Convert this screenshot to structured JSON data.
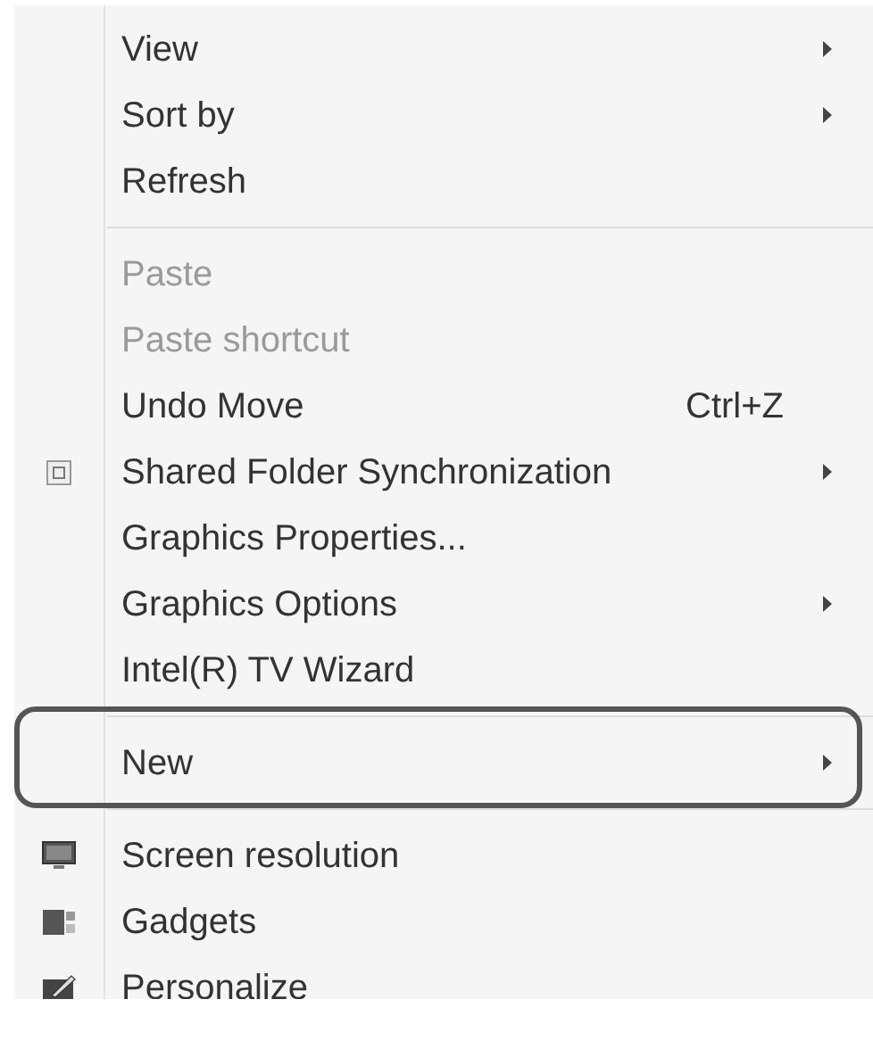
{
  "menu": {
    "items": [
      {
        "kind": "item",
        "label": "View",
        "submenu": true,
        "disabled": false
      },
      {
        "kind": "item",
        "label": "Sort by",
        "submenu": true,
        "disabled": false
      },
      {
        "kind": "item",
        "label": "Refresh",
        "submenu": false,
        "disabled": false
      },
      {
        "kind": "separator"
      },
      {
        "kind": "item",
        "label": "Paste",
        "submenu": false,
        "disabled": true
      },
      {
        "kind": "item",
        "label": "Paste shortcut",
        "submenu": false,
        "disabled": true
      },
      {
        "kind": "item",
        "label": "Undo Move",
        "shortcut": "Ctrl+Z",
        "submenu": false,
        "disabled": false
      },
      {
        "kind": "iconitem",
        "label": "Shared Folder Synchronization",
        "submenu": true,
        "disabled": false
      },
      {
        "kind": "item",
        "label": "Graphics Properties...",
        "submenu": false,
        "disabled": false
      },
      {
        "kind": "item",
        "label": "Graphics Options",
        "submenu": true,
        "disabled": false
      },
      {
        "kind": "item",
        "label": "Intel(R) TV Wizard",
        "submenu": false,
        "disabled": false
      },
      {
        "kind": "separator"
      },
      {
        "kind": "item",
        "label": "New",
        "submenu": true,
        "disabled": false,
        "highlighted": true
      },
      {
        "kind": "separator"
      },
      {
        "kind": "iconitem",
        "label": "Screen resolution",
        "submenu": false,
        "disabled": false
      },
      {
        "kind": "iconitem",
        "label": "Gadgets",
        "submenu": false,
        "disabled": false
      },
      {
        "kind": "iconitem",
        "label": "Personalize",
        "submenu": false,
        "disabled": false
      }
    ]
  }
}
